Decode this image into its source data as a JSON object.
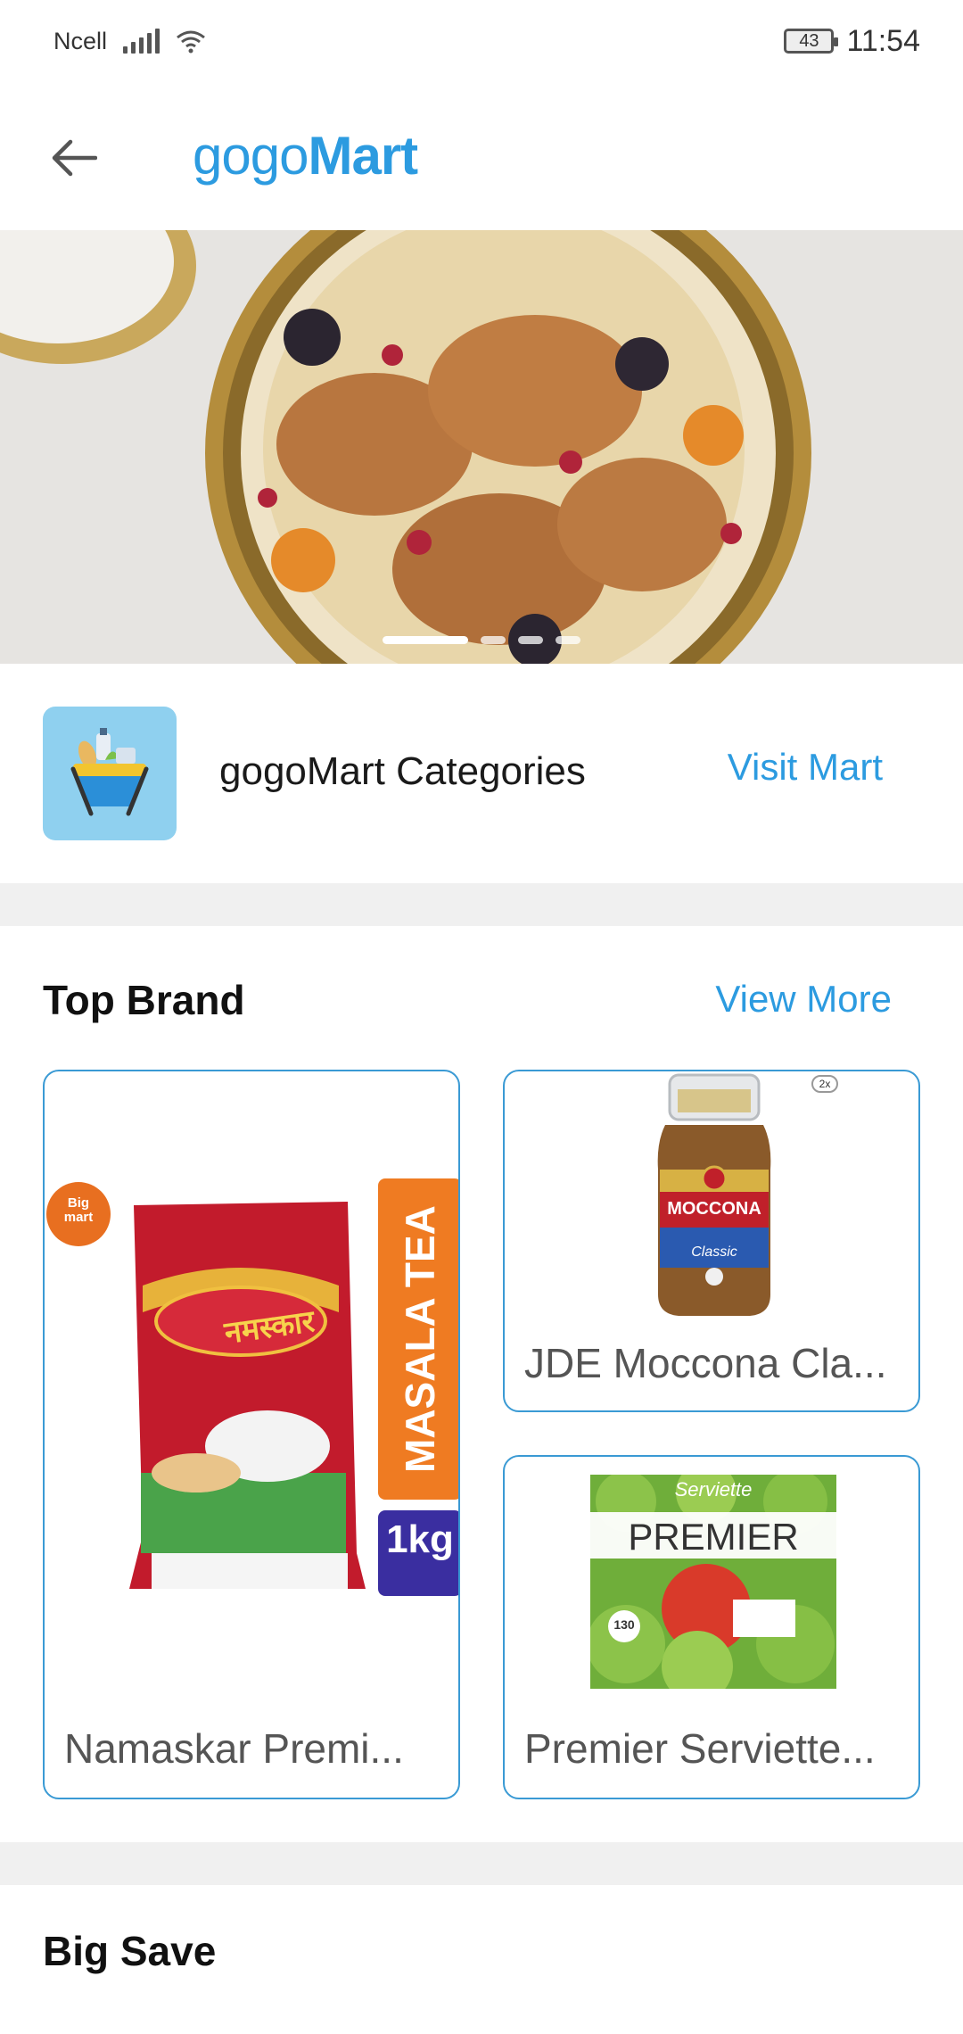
{
  "status_bar": {
    "carrier": "Ncell",
    "battery": "43",
    "time": "11:54"
  },
  "app_bar": {
    "title_part1": "gogo",
    "title_part2": "Mart"
  },
  "banner": {
    "dot_count": 4,
    "active_dot": 0
  },
  "categories": {
    "title": "gogoMart Categories",
    "link": "Visit Mart"
  },
  "top_brand": {
    "title": "Top Brand",
    "link": "View More",
    "products": [
      {
        "name": "Namaskar Premi...",
        "badge": "Big mart",
        "side_label": "MASALA TEA",
        "weight": "1kg",
        "pack_text": "नमस्कार"
      },
      {
        "name": "JDE Moccona Cla...",
        "brand_label": "MOCCONA",
        "sub_label": "Classic",
        "corner_badge": "2x"
      },
      {
        "name": "Premier Serviette...",
        "top_label": "Serviette",
        "brand_label": "PREMIER",
        "count": "130"
      }
    ]
  },
  "big_save": {
    "title": "Big Save"
  },
  "colors": {
    "accent": "#2c9be0",
    "card_border": "#3a9ad4",
    "divider": "#f0f0f0"
  }
}
